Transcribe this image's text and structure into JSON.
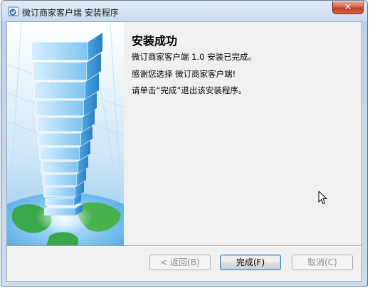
{
  "window": {
    "title": "微订商家客户端 安装程序",
    "close_glyph": "✕"
  },
  "content": {
    "heading": "安装成功",
    "line1": "微订商家客户端 1.0 安装已完成。",
    "line2": "感谢您选择 微订商家客户端!",
    "line3": "请单击“完成”退出该安装程序。"
  },
  "buttons": {
    "back": "< 返回(B)",
    "finish": "完成(F)",
    "cancel": "取消(C)"
  },
  "icons": {
    "app": "installer-app-icon",
    "close": "close-icon",
    "cursor": "mouse-pointer-icon"
  },
  "colors": {
    "title_bar": "#c9dcef",
    "close_button": "#c0391f",
    "client_bg": "#f0f0f0",
    "default_button_border": "#3c7fb1"
  }
}
